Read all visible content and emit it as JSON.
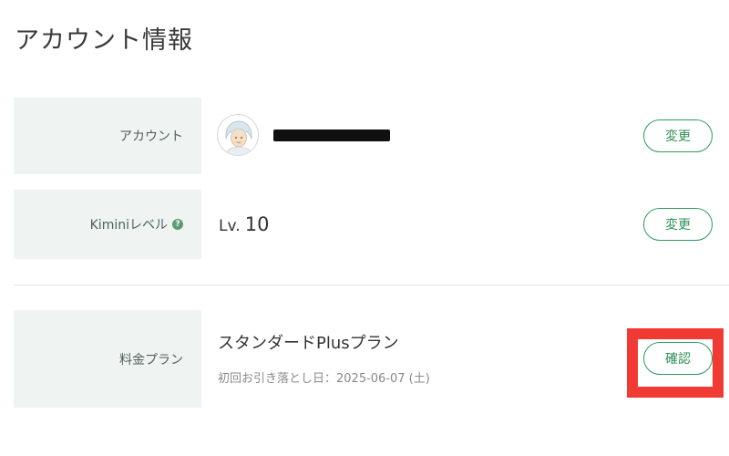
{
  "page_title": "アカウント情報",
  "rows": {
    "account": {
      "label": "アカウント",
      "button_label": "変更"
    },
    "level": {
      "label": "Kiminiレベル",
      "help_icon_glyph": "?",
      "value_prefix": "Lv.",
      "value_number": "10",
      "button_label": "変更"
    },
    "plan": {
      "label": "料金プラン",
      "plan_name": "スタンダードPlusプラン",
      "next_billing": "初回お引き落とし日：2025-06-07 (土)",
      "button_label": "確認"
    }
  },
  "icons": {
    "avatar": "user-avatar-icon",
    "help": "help-icon"
  },
  "colors": {
    "accent": "#2e9a5c",
    "label_background": "#eff4f2",
    "highlight": "#f03a33"
  }
}
